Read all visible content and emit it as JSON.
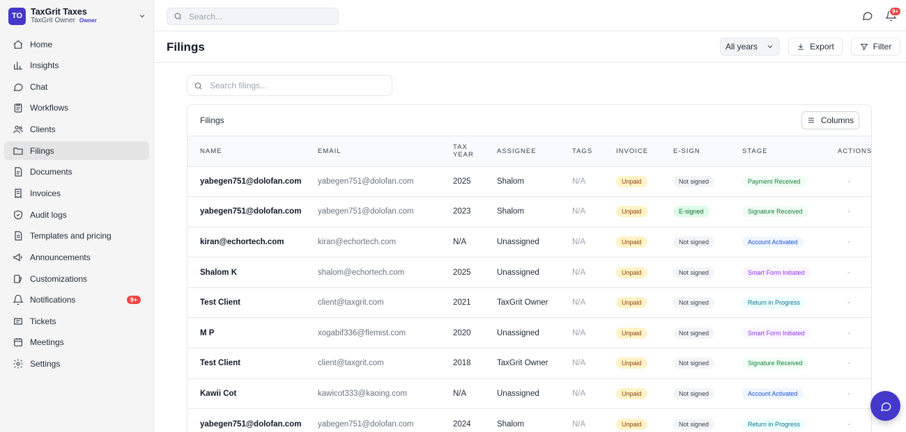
{
  "org": {
    "initials": "TO",
    "name": "TaxGrit Taxes",
    "role": "TaxGrit Owner",
    "tag": "Owner"
  },
  "nav": [
    {
      "label": "Home",
      "icon": "home-icon"
    },
    {
      "label": "Insights",
      "icon": "bar-chart-icon"
    },
    {
      "label": "Chat",
      "icon": "chat-icon"
    },
    {
      "label": "Workflows",
      "icon": "clipboard-icon"
    },
    {
      "label": "Clients",
      "icon": "users-icon"
    },
    {
      "label": "Filings",
      "icon": "folder-icon",
      "active": true
    },
    {
      "label": "Documents",
      "icon": "document-icon"
    },
    {
      "label": "Invoices",
      "icon": "receipt-icon"
    },
    {
      "label": "Audit logs",
      "icon": "shield-icon"
    },
    {
      "label": "Templates and pricing",
      "icon": "template-icon"
    },
    {
      "label": "Announcements",
      "icon": "megaphone-icon"
    },
    {
      "label": "Customizations",
      "icon": "palette-icon"
    },
    {
      "label": "Notifications",
      "icon": "bell-icon",
      "badge": "9+"
    },
    {
      "label": "Tickets",
      "icon": "ticket-icon"
    },
    {
      "label": "Meetings",
      "icon": "calendar-icon"
    },
    {
      "label": "Settings",
      "icon": "gear-icon"
    }
  ],
  "topbar": {
    "search_placeholder": "Search...",
    "notification_badge": "9+"
  },
  "header": {
    "title": "Filings",
    "year_filter": "All years",
    "export_label": "Export",
    "filter_label": "Filter"
  },
  "filings": {
    "search_placeholder": "Search filings...",
    "card_title": "Filings",
    "columns_label": "Columns",
    "headers": [
      "NAME",
      "EMAIL",
      "TAX YEAR",
      "ASSIGNEE",
      "TAGS",
      "INVOICE",
      "E-SIGN",
      "STAGE",
      "ACTIONS"
    ],
    "rows": [
      {
        "name": "yabegen751@dolofan.com",
        "email": "yabegen751@dolofan.com",
        "year": "2025",
        "assignee": "Shalom",
        "tags": "N/A",
        "invoice": "Unpaid",
        "esign": "Not signed",
        "stage": "Payment Received",
        "stage_color": "green",
        "actions": "-"
      },
      {
        "name": "yabegen751@dolofan.com",
        "email": "yabegen751@dolofan.com",
        "year": "2023",
        "assignee": "Shalom",
        "tags": "N/A",
        "invoice": "Unpaid",
        "esign": "E-signed",
        "stage": "Signature Received",
        "stage_color": "green",
        "actions": "-"
      },
      {
        "name": "kiran@echortech.com",
        "email": "kiran@echortech.com",
        "year": "N/A",
        "assignee": "Unassigned",
        "tags": "N/A",
        "invoice": "Unpaid",
        "esign": "Not signed",
        "stage": "Account Activated",
        "stage_color": "blue",
        "actions": "-"
      },
      {
        "name": "Shalom K",
        "email": "shalom@echortech.com",
        "year": "2025",
        "assignee": "Unassigned",
        "tags": "N/A",
        "invoice": "Unpaid",
        "esign": "Not signed",
        "stage": "Smart Form Initiated",
        "stage_color": "purple",
        "actions": "-"
      },
      {
        "name": "Test Client",
        "email": "client@taxgrit.com",
        "year": "2021",
        "assignee": "TaxGrit Owner",
        "tags": "N/A",
        "invoice": "Unpaid",
        "esign": "Not signed",
        "stage": "Return in Progress",
        "stage_color": "teal",
        "actions": "-"
      },
      {
        "name": "M P",
        "email": "xogabif336@flemist.com",
        "year": "2020",
        "assignee": "Unassigned",
        "tags": "N/A",
        "invoice": "Unpaid",
        "esign": "Not signed",
        "stage": "Smart Form Initiated",
        "stage_color": "purple",
        "actions": "-"
      },
      {
        "name": "Test Client",
        "email": "client@taxgrit.com",
        "year": "2018",
        "assignee": "TaxGrit Owner",
        "tags": "N/A",
        "invoice": "Unpaid",
        "esign": "Not signed",
        "stage": "Signature Received",
        "stage_color": "green",
        "actions": "-"
      },
      {
        "name": "Kawii Cot",
        "email": "kawicot333@kaoing.com",
        "year": "N/A",
        "assignee": "Unassigned",
        "tags": "N/A",
        "invoice": "Unpaid",
        "esign": "Not signed",
        "stage": "Account Activated",
        "stage_color": "blue",
        "actions": "-"
      },
      {
        "name": "yabegen751@dolofan.com",
        "email": "yabegen751@dolofan.com",
        "year": "2024",
        "assignee": "Shalom",
        "tags": "N/A",
        "invoice": "Unpaid",
        "esign": "Not signed",
        "stage": "Return in Progress",
        "stage_color": "teal",
        "actions": "-"
      }
    ]
  }
}
